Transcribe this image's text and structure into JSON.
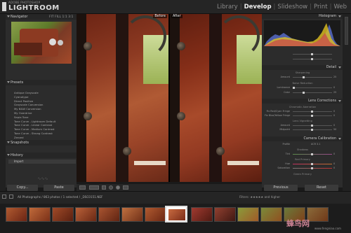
{
  "app": {
    "brand_small": "ADOBE PHOTOSHOP",
    "brand": "LIGHTROOM",
    "version": "1.0",
    "modules": [
      "Library",
      "Develop",
      "Slideshow",
      "Print",
      "Web"
    ],
    "active_module": "Develop"
  },
  "left_panel": {
    "navigator": {
      "title": "Navigator",
      "zoom_options": "FIT  FILL  1:1  3:1"
    },
    "presets": {
      "title": "Presets",
      "items": [
        "Antique Grayscale",
        "Cyanotype",
        "Direct Positive",
        "Grayscale Conversion",
        "My B&W Conversion",
        "My Overdrive",
        "Sepia Tone",
        "Tone Curve - Lightroom Default",
        "Tone Curve - Linear Contrast",
        "Tone Curve - Medium Contrast",
        "Tone Curve - Strong Contrast",
        "Zeroed"
      ]
    },
    "snapshots": {
      "title": "Snapshots",
      "items": [
        "Import"
      ]
    },
    "history": {
      "title": "History"
    },
    "copy_label": "Copy...",
    "paste_label": "Paste"
  },
  "center": {
    "before_label": "Before",
    "after_label": "After"
  },
  "toolbar": {
    "text": ""
  },
  "right_panel": {
    "histogram": {
      "title": "Histogram"
    },
    "detail": {
      "title": "Detail",
      "sharpening_label": "Sharpening",
      "sharpening_row": {
        "label": "Amount",
        "value": "25"
      },
      "noise_label": "Noise Reduction",
      "luminance_row": {
        "label": "Luminance",
        "value": "0"
      },
      "color_row": {
        "label": "Color",
        "value": "25"
      }
    },
    "lens": {
      "title": "Lens Corrections",
      "chromatic_label": "Chromatic Aberration",
      "red_cyan": {
        "label": "Fix Red/Cyan Fringe",
        "value": "0"
      },
      "blue_yellow": {
        "label": "Fix Blue/Yellow Fringe",
        "value": "0"
      },
      "vignetting_label": "Lens Vignetting",
      "amount": {
        "label": "Amount",
        "value": "0"
      },
      "midpoint": {
        "label": "Midpoint",
        "value": "50"
      }
    },
    "calibration": {
      "title": "Camera Calibration",
      "profile": {
        "label": "Profile",
        "value": "ACR 3.1"
      },
      "shadows_label": "Shadows",
      "tint": {
        "label": "Tint",
        "value": "0"
      },
      "red_primary_label": "Red Primary",
      "hue": {
        "label": "Hue",
        "value": "0"
      },
      "saturation": {
        "label": "Saturation",
        "value": "0"
      },
      "green_primary_label": "Green Primary"
    },
    "previous_label": "Previous",
    "reset_label": "Reset"
  },
  "filmstrip": {
    "info": "All Photographs / 863 photos / 1 selected / _DSC0151.NEF",
    "filter": "Filters:",
    "filter_rating": "and higher"
  },
  "watermark": {
    "text": "蜂鸟网",
    "url": "www.fengniao.com"
  },
  "colors": {
    "accent": "#f0f0f0",
    "panel": "#2c2c2c",
    "background": "#1a1a1a"
  }
}
